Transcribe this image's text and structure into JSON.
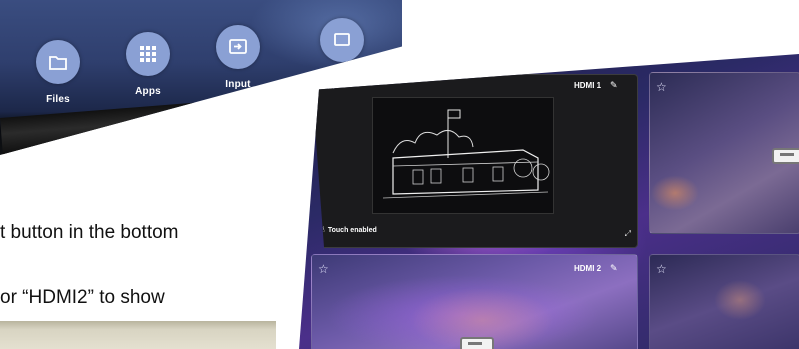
{
  "dock": {
    "items": [
      {
        "label": "Files",
        "icon": "folder-icon"
      },
      {
        "label": "Apps",
        "icon": "apps-grid-icon"
      },
      {
        "label": "Input",
        "icon": "input-source-icon"
      },
      {
        "label": "",
        "icon": "screen-cast-icon"
      }
    ],
    "accent": "#8aa0d4"
  },
  "document": {
    "line1": "t button in the bottom",
    "line2": "or “HDMI2” to show"
  },
  "sources": {
    "tiles": [
      {
        "name": "HDMI 1",
        "starred": true,
        "touch_label": "Touch enabled"
      },
      {
        "name": "",
        "starred": false
      },
      {
        "name": "HDMI 2",
        "starred": false
      },
      {
        "name": "",
        "starred": false
      }
    ]
  }
}
